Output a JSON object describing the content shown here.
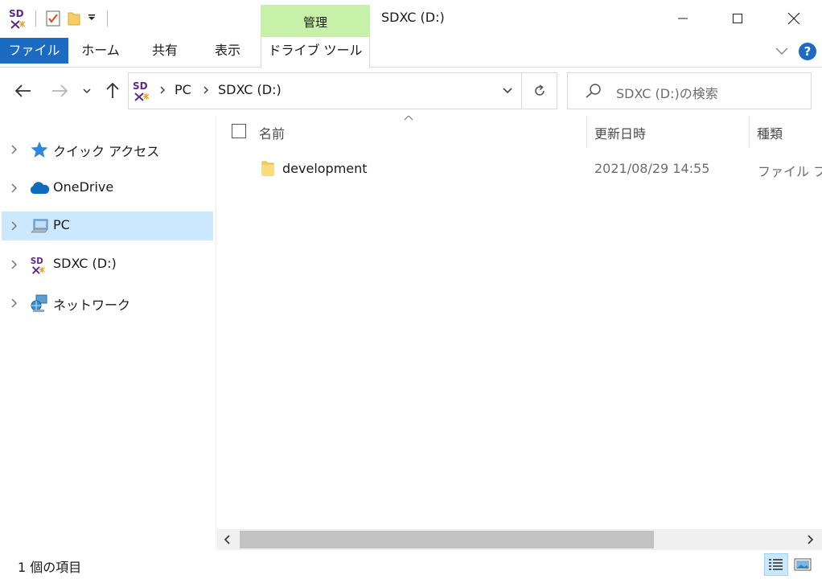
{
  "window": {
    "title": "SDXC (D:)",
    "context_tab_group": "管理"
  },
  "ribbon": {
    "tabs": [
      "ファイル",
      "ホーム",
      "共有",
      "表示",
      "ドライブ ツール"
    ],
    "help_label": "?"
  },
  "address": {
    "crumbs": [
      "PC",
      "SDXC (D:)"
    ]
  },
  "search": {
    "placeholder": "SDXC (D:)の検索"
  },
  "nav_pane": {
    "items": [
      {
        "label": "クイック アクセス",
        "icon": "star-icon"
      },
      {
        "label": "OneDrive",
        "icon": "cloud-icon"
      },
      {
        "label": "PC",
        "icon": "computer-icon",
        "selected": true
      },
      {
        "label": "SDXC (D:)",
        "icon": "sd-card-icon"
      },
      {
        "label": "ネットワーク",
        "icon": "network-icon"
      }
    ]
  },
  "file_list": {
    "columns": [
      "名前",
      "更新日時",
      "種類"
    ],
    "rows": [
      {
        "name": "development",
        "modified": "2021/08/29 14:55",
        "type": "ファイル フォ"
      }
    ]
  },
  "status": {
    "item_count": "1 個の項目"
  },
  "colors": {
    "accent": "#1a6bc1",
    "selection": "#cce8ff",
    "context_tab": "#c7f0a8",
    "folder": "#f4cf63"
  }
}
